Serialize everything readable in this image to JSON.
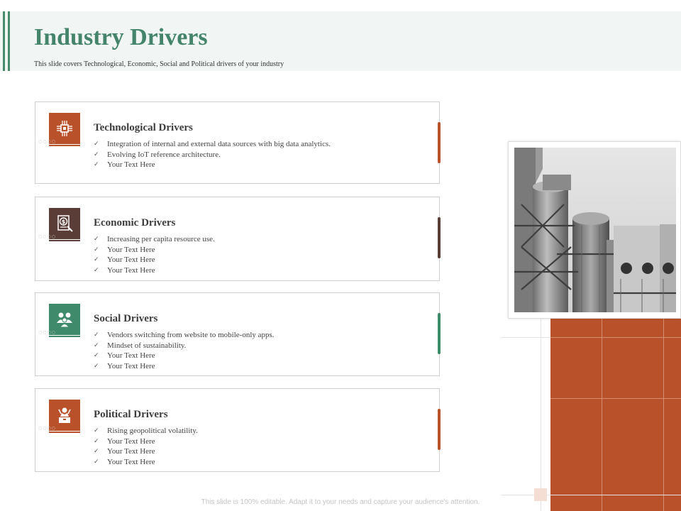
{
  "header": {
    "title": "Industry Drivers",
    "subtitle": "This slide covers Technological,  Economic, Social and Political drivers of your industry"
  },
  "colors": {
    "accent_green": "#44846a",
    "orange": "#b9522b",
    "brown": "#5a3d36",
    "green": "#3f8a6a"
  },
  "cards": [
    {
      "title": "Technological Drivers",
      "icon": "circuit-chip-icon",
      "color": "#b9522b",
      "bullets": [
        "Integration of internal  and external  data sources with  big data analytics.",
        "Evolving IoT  reference architecture.",
        "Your Text  Here"
      ]
    },
    {
      "title": "Economic Drivers",
      "icon": "dollar-document-icon",
      "color": "#5a3d36",
      "bullets": [
        "Increasing per capita resource use.",
        "Your Text Here",
        "Your Text Here",
        "Your Text Here"
      ]
    },
    {
      "title": "Social Drivers",
      "icon": "people-group-icon",
      "color": "#3f8a6a",
      "bullets": [
        "Vendors switching from website to mobile-only apps.",
        "Mindset of sustainability.",
        "Your Text Here",
        "Your Text Here"
      ]
    },
    {
      "title": "Political Drivers",
      "icon": "podium-speaker-icon",
      "color": "#b9522b",
      "bullets": [
        "Rising geopolitical volatility.",
        "Your Text Here",
        "Your Text Here",
        "Your Text Here"
      ]
    }
  ],
  "photo": {
    "subject": "industrial-silos-photo"
  },
  "footer": "This slide is 100% editable.  Adapt it to your needs and capture your audience's attention."
}
